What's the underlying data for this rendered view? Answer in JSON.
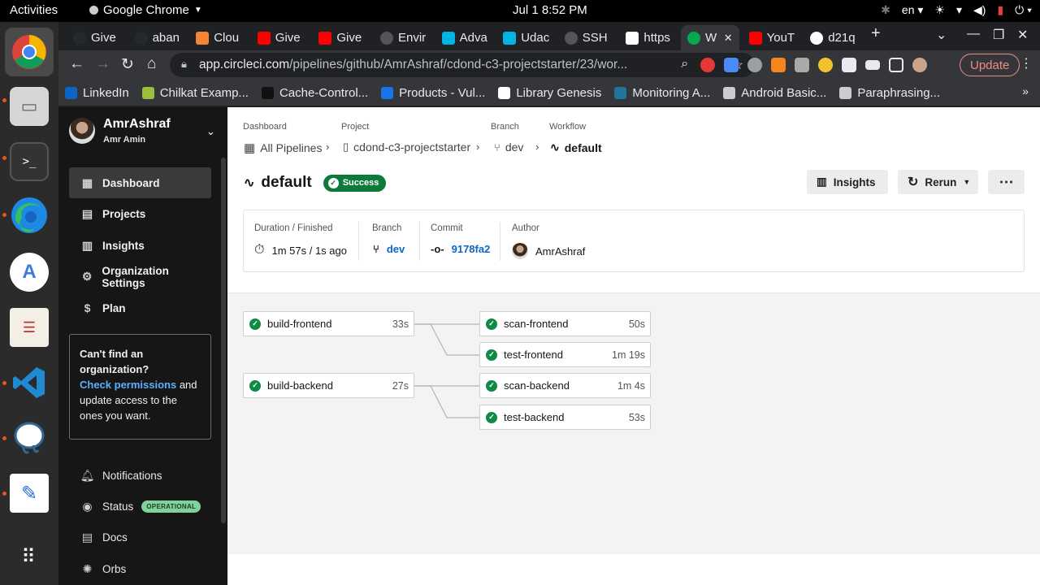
{
  "os": {
    "activities": "Activities",
    "app_menu": "Google Chrome",
    "clock": "Jul 1  8:52 PM",
    "lang": "en"
  },
  "tabs": [
    {
      "label": "Give",
      "favicon": "github-icon",
      "color": "#24292e"
    },
    {
      "label": "aban",
      "favicon": "github-icon",
      "color": "#24292e"
    },
    {
      "label": "Clou",
      "favicon": "aws-icon",
      "color": "#f58536"
    },
    {
      "label": "Give",
      "favicon": "youtube-icon",
      "color": "#ff0000"
    },
    {
      "label": "Give",
      "favicon": "youtube-icon",
      "color": "#ff0000"
    },
    {
      "label": "Envir",
      "favicon": "circleci-icon",
      "color": "#555555"
    },
    {
      "label": "Adva",
      "favicon": "udacity-icon",
      "color": "#02b3e4"
    },
    {
      "label": "Udac",
      "favicon": "udacity-icon",
      "color": "#02b3e4"
    },
    {
      "label": "SSH",
      "favicon": "circleci-icon",
      "color": "#555555"
    },
    {
      "label": "https",
      "favicon": "k-icon",
      "color": "#ffffff"
    },
    {
      "label": "W",
      "favicon": "circleci-icon",
      "color": "#04aa51",
      "active": true
    },
    {
      "label": "YouT",
      "favicon": "youtube-icon",
      "color": "#ff0000"
    },
    {
      "label": "d21q",
      "favicon": "globe-icon",
      "color": "#ffffff"
    }
  ],
  "toolbar": {
    "url_host": "app.circleci.com",
    "url_path": "/pipelines/github/AmrAshraf/cdond-c3-projectstarter/23/wor...",
    "update_label": "Update"
  },
  "bookmarks": [
    {
      "label": "LinkedIn",
      "color": "#0a66c2"
    },
    {
      "label": "Chilkat Examp...",
      "color": "#9bbf3c"
    },
    {
      "label": "Cache-Control...",
      "color": "#111111"
    },
    {
      "label": "Products - Vul...",
      "color": "#1a73e8"
    },
    {
      "label": "Library Genesis",
      "color": "#ffffff"
    },
    {
      "label": "Monitoring A...",
      "color": "#21759b"
    },
    {
      "label": "Android Basic...",
      "color": "#cccccc"
    },
    {
      "label": "Paraphrasing...",
      "color": "#cccccc"
    }
  ],
  "sidebar": {
    "user_name": "AmrAshraf",
    "user_sub": "Amr Amin",
    "nav": [
      {
        "label": "Dashboard",
        "icon": "dashboard-icon",
        "active": true
      },
      {
        "label": "Projects",
        "icon": "projects-icon"
      },
      {
        "label": "Insights",
        "icon": "insights-icon"
      },
      {
        "label": "Organization Settings",
        "icon": "gear-icon"
      },
      {
        "label": "Plan",
        "icon": "dollar-icon"
      }
    ],
    "org_question": "Can't find an organization?",
    "org_link": "Check permissions",
    "org_text_after": " and update access to the ones you want.",
    "bottom": [
      {
        "label": "Notifications",
        "icon": "bell-icon"
      },
      {
        "label": "Status",
        "icon": "status-icon",
        "badge": "OPERATIONAL"
      },
      {
        "label": "Docs",
        "icon": "docs-icon"
      },
      {
        "label": "Orbs",
        "icon": "orbs-icon"
      }
    ]
  },
  "breadcrumb": {
    "dashboard_head": "Dashboard",
    "dashboard": "All Pipelines",
    "project_head": "Project",
    "project": "cdond-c3-projectstarter",
    "branch_head": "Branch",
    "branch": "dev",
    "workflow_head": "Workflow",
    "workflow": "default"
  },
  "workflow": {
    "title": "default",
    "status": "Success",
    "insights_label": "Insights",
    "rerun_label": "Rerun",
    "more_label": "⋯"
  },
  "info": {
    "duration_label": "Duration / Finished",
    "duration_value": "1m 57s / 1s ago",
    "branch_label": "Branch",
    "branch_value": "dev",
    "commit_label": "Commit",
    "commit_value": "9178fa2",
    "author_label": "Author",
    "author_value": "AmrAshraf"
  },
  "jobs": [
    {
      "name": "build-frontend",
      "duration": "33s"
    },
    {
      "name": "build-backend",
      "duration": "27s"
    },
    {
      "name": "scan-frontend",
      "duration": "50s"
    },
    {
      "name": "test-frontend",
      "duration": "1m 19s"
    },
    {
      "name": "scan-backend",
      "duration": "1m 4s"
    },
    {
      "name": "test-backend",
      "duration": "53s"
    }
  ],
  "colors": {
    "success": "#0d7a3a",
    "link": "#0a67c2",
    "update": "#f28b82"
  }
}
